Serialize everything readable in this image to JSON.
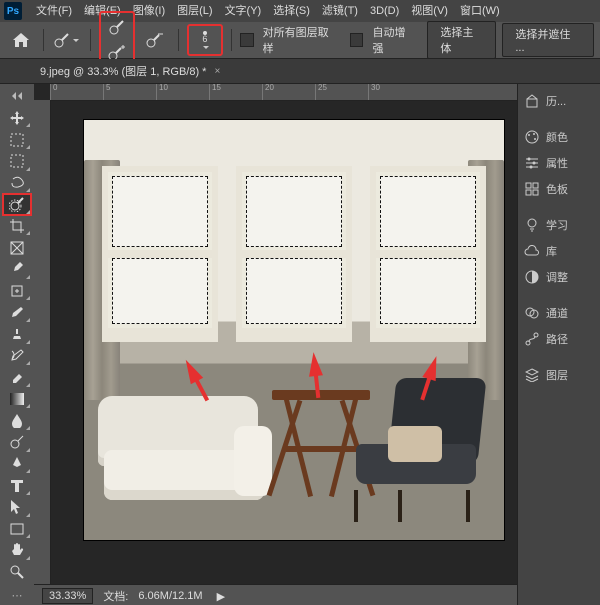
{
  "menu": [
    "文件(F)",
    "编辑(E)",
    "图像(I)",
    "图层(L)",
    "文字(Y)",
    "选择(S)",
    "滤镜(T)",
    "3D(D)",
    "视图(V)",
    "窗口(W)"
  ],
  "options": {
    "sample_all_layers": "对所有图层取样",
    "auto_enhance": "自动增强",
    "select_subject": "选择主体",
    "select_and_mask": "选择并遮住 ...",
    "brush_size": "6"
  },
  "tab": {
    "title": "9.jpeg @ 33.3% (图层 1, RGB/8) *"
  },
  "ruler_ticks": [
    "0",
    "5",
    "10",
    "15",
    "20",
    "25",
    "30"
  ],
  "status": {
    "zoom": "33.33%",
    "docsize_label": "文档:",
    "docsize": "6.06M/12.1M"
  },
  "panels": [
    "历...",
    "颜色",
    "属性",
    "色板",
    "学习",
    "库",
    "调整",
    "通道",
    "路径",
    "图层"
  ],
  "tools": [
    "move-tool",
    "artboard-tool",
    "rect-marquee-tool",
    "lasso-tool",
    "quick-select-tool",
    "crop-tool",
    "frame-tool",
    "eyedropper-tool",
    "spot-heal-tool",
    "brush-tool",
    "clone-stamp-tool",
    "history-brush-tool",
    "eraser-tool",
    "gradient-tool",
    "blur-tool",
    "dodge-tool",
    "pen-tool",
    "type-tool",
    "path-select-tool",
    "rectangle-tool",
    "hand-tool",
    "zoom-tool"
  ]
}
